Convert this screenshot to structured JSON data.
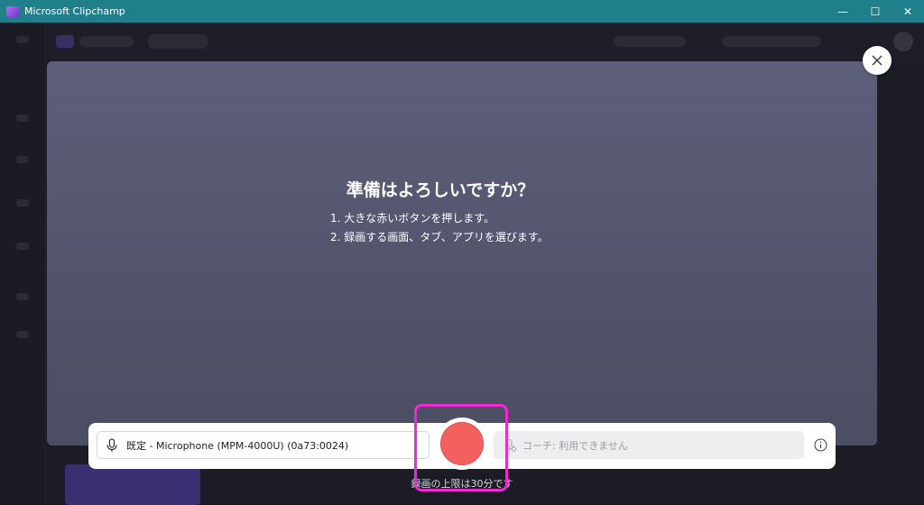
{
  "window": {
    "title": "Microsoft Clipchamp",
    "minimize_glyph": "—",
    "maximize_glyph": "☐",
    "close_glyph": "✕"
  },
  "recorder": {
    "heading": "準備はよろしいですか？",
    "steps": [
      "1. 大きな赤いボタンを押します。",
      "2. 録画する画面、タブ、アプリを選びます。"
    ],
    "microphone": {
      "icon": "microphone-icon",
      "selected": "既定 - Microphone (MPM-4000U) (0a73:0024)"
    },
    "coach": {
      "icon": "coach-icon",
      "text": "コーチ: 利用できません"
    },
    "record_button": {
      "icon": "record-icon",
      "color": "#f2605f"
    },
    "info_icon": "info-icon",
    "close_icon": "close-icon",
    "limit_text": "録画の上限は30分です"
  },
  "colors": {
    "titlebar": "#1f7f8b",
    "panel_top": "#5d5e7a",
    "panel_bottom": "#4b4d62",
    "highlight": "#ee2bd3",
    "record": "#f2605f"
  }
}
